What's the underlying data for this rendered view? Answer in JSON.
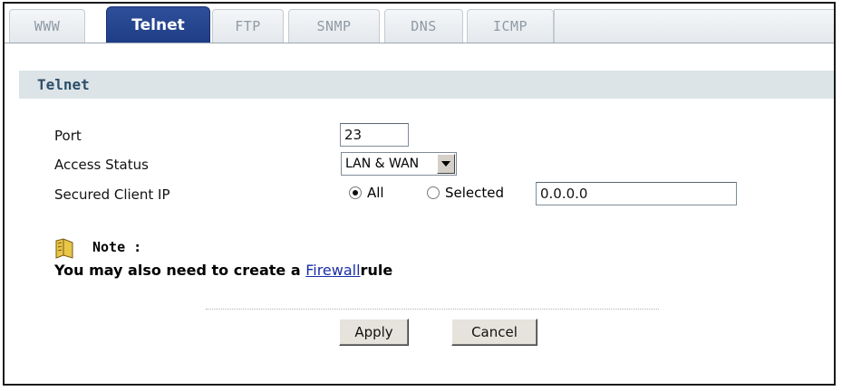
{
  "tabs": [
    {
      "label": "WWW",
      "active": false
    },
    {
      "label": "Telnet",
      "active": true
    },
    {
      "label": "FTP",
      "active": false
    },
    {
      "label": "SNMP",
      "active": false
    },
    {
      "label": "DNS",
      "active": false
    },
    {
      "label": "ICMP",
      "active": false
    }
  ],
  "section": {
    "title": "Telnet"
  },
  "form": {
    "port": {
      "label": "Port",
      "value": "23"
    },
    "access_status": {
      "label": "Access Status",
      "selected": "LAN & WAN"
    },
    "secured_client_ip": {
      "label": "Secured Client IP",
      "option_all": "All",
      "option_selected": "Selected",
      "selected_option": "All",
      "ip_value": "0.0.0.0"
    }
  },
  "note": {
    "icon": "note-pin-icon",
    "label": "Note :",
    "text_before": "You may also need to create a ",
    "link_text": "Firewall",
    "text_after": "rule"
  },
  "buttons": {
    "apply": "Apply",
    "cancel": "Cancel"
  },
  "colors": {
    "active_tab": "#1f3d86",
    "section_header_bg": "#dde4e8",
    "link": "#1a2ea8"
  }
}
